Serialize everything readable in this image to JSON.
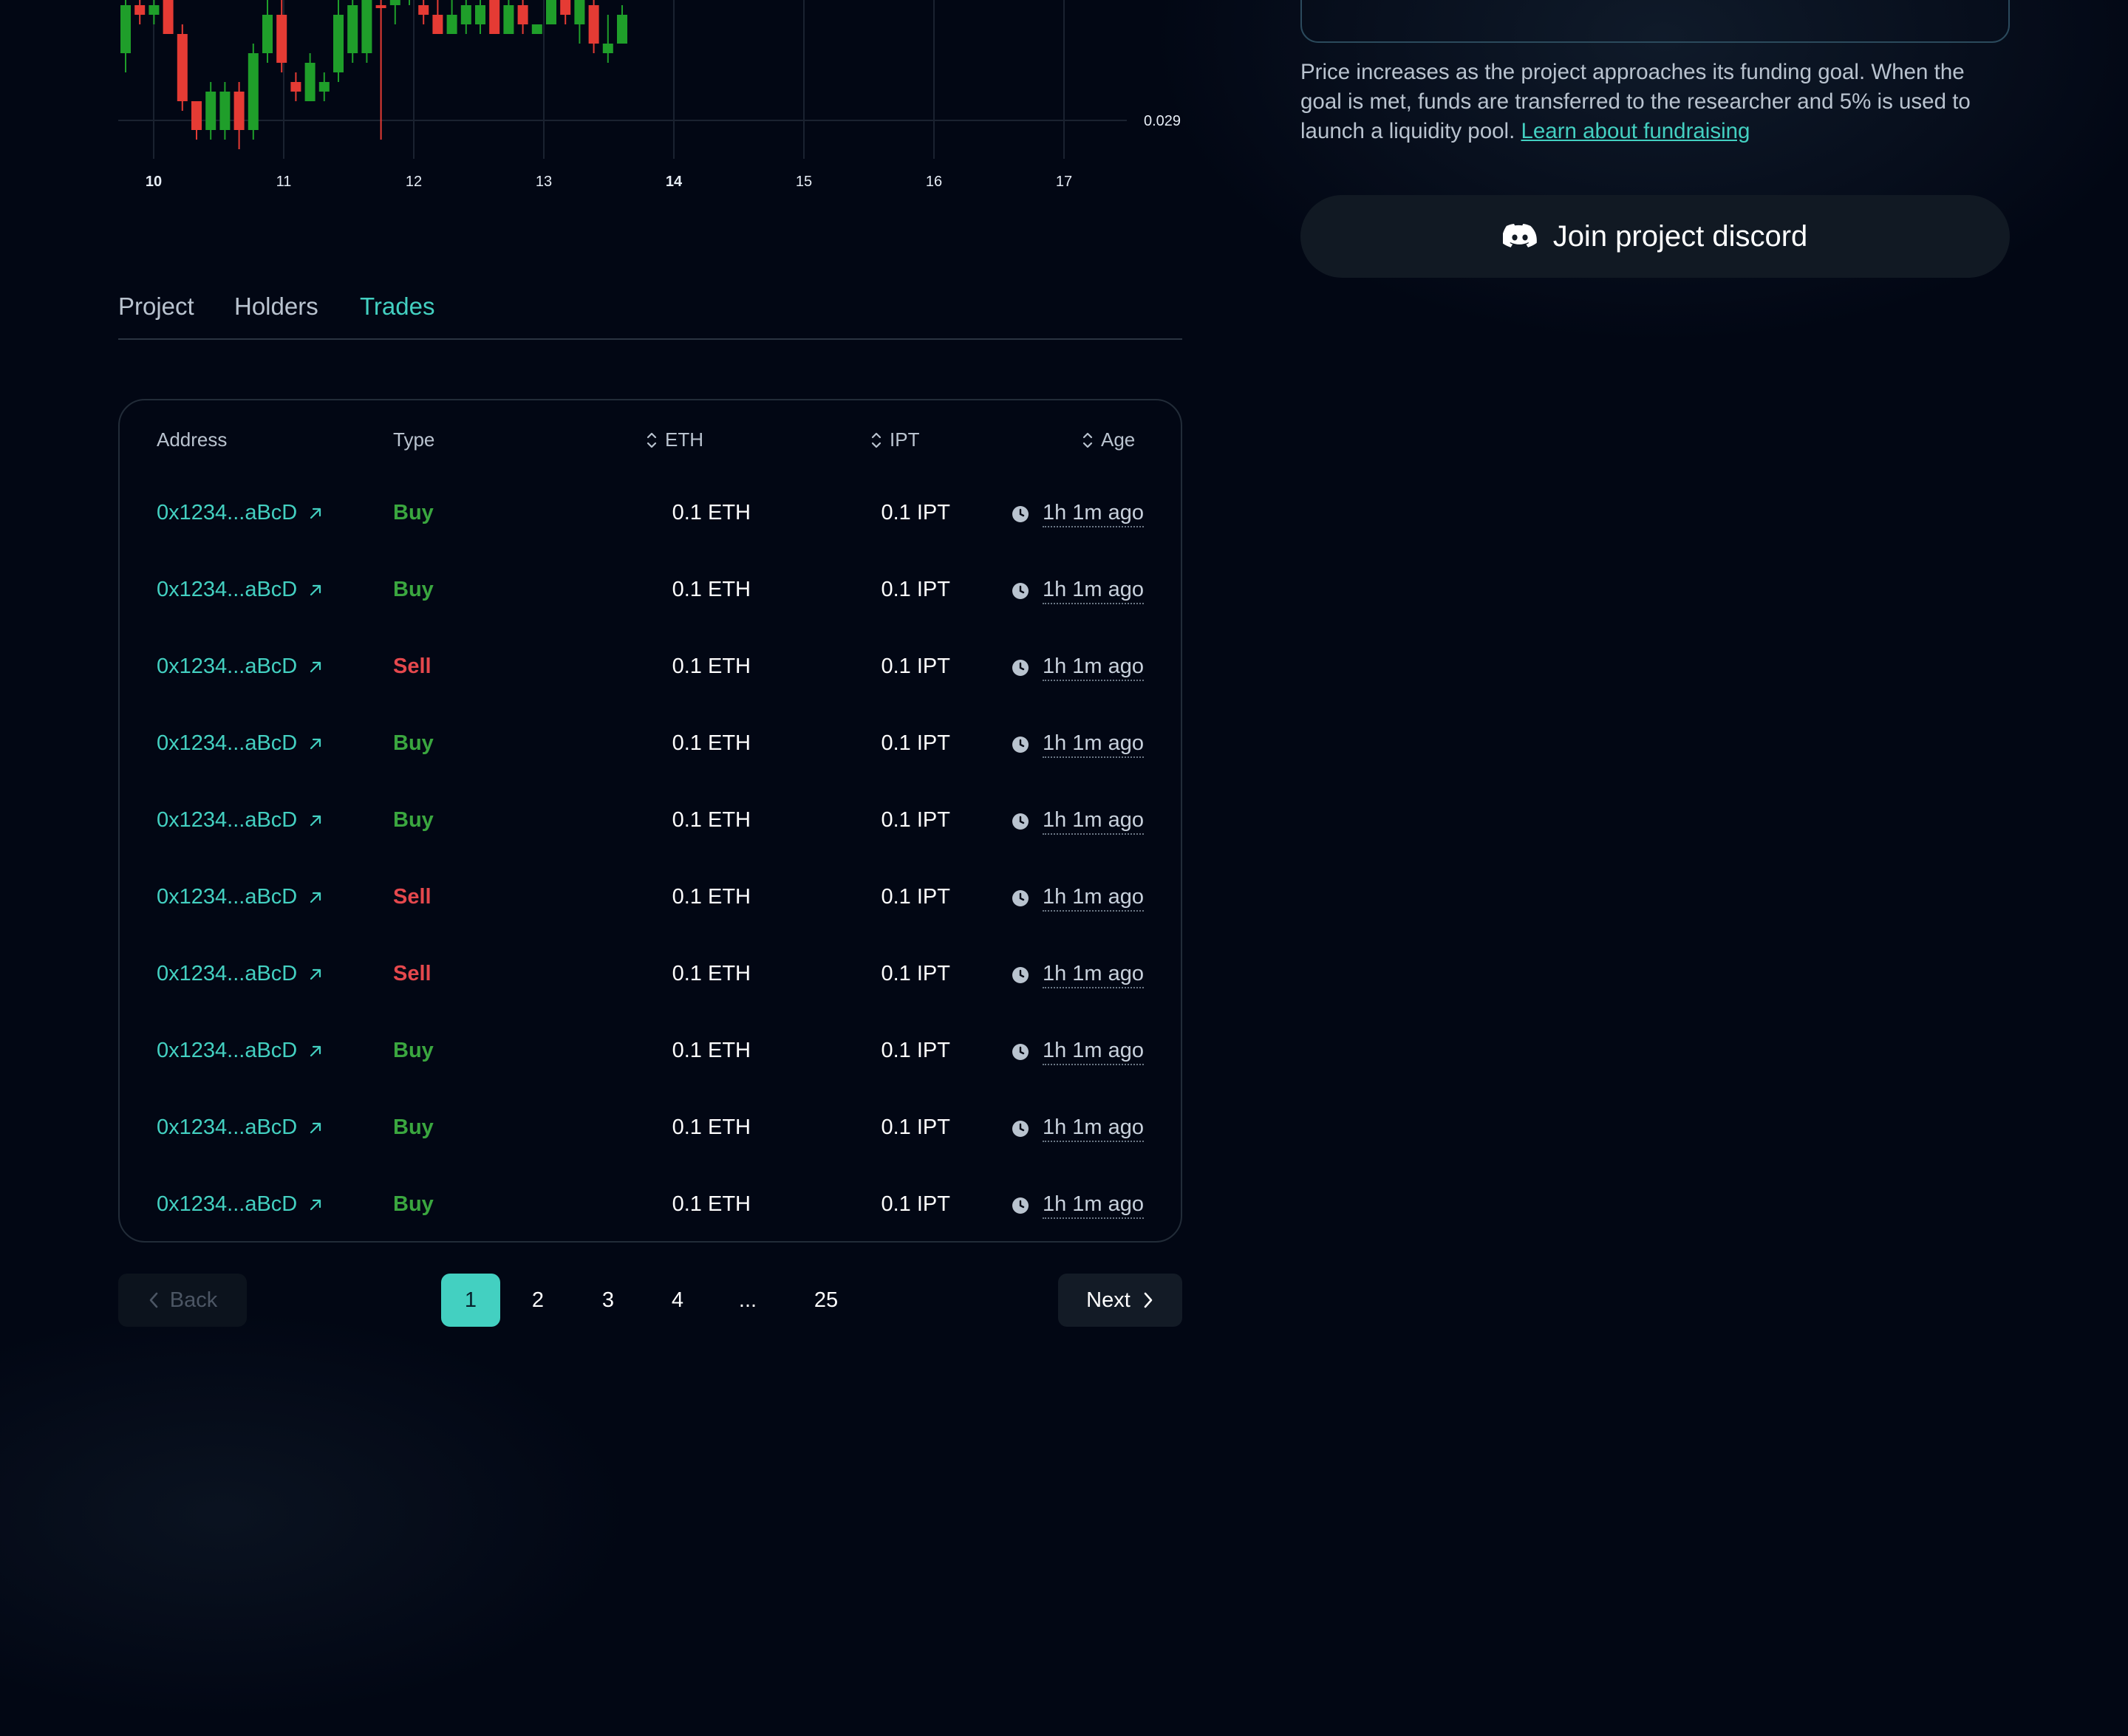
{
  "chart_data": {
    "type": "candlestick",
    "x_ticks": [
      "10",
      "11",
      "12",
      "13",
      "14",
      "15",
      "16",
      "17"
    ],
    "bold_ticks": [
      "10",
      "14"
    ],
    "y_tick_visible": "0.029",
    "candles": [
      {
        "o": 0.0297,
        "h": 0.0303,
        "l": 0.0295,
        "c": 0.0302,
        "dir": "up"
      },
      {
        "o": 0.0302,
        "h": 0.0303,
        "l": 0.03,
        "c": 0.0301,
        "dir": "down"
      },
      {
        "o": 0.0301,
        "h": 0.0303,
        "l": 0.03,
        "c": 0.0302,
        "dir": "up"
      },
      {
        "o": 0.0303,
        "h": 0.0303,
        "l": 0.0299,
        "c": 0.0299,
        "dir": "down"
      },
      {
        "o": 0.0299,
        "h": 0.03,
        "l": 0.0291,
        "c": 0.0292,
        "dir": "down"
      },
      {
        "o": 0.0292,
        "h": 0.0292,
        "l": 0.0288,
        "c": 0.0289,
        "dir": "down"
      },
      {
        "o": 0.0289,
        "h": 0.0294,
        "l": 0.0288,
        "c": 0.0293,
        "dir": "up"
      },
      {
        "o": 0.0289,
        "h": 0.0294,
        "l": 0.0288,
        "c": 0.0293,
        "dir": "up"
      },
      {
        "o": 0.0293,
        "h": 0.0294,
        "l": 0.0287,
        "c": 0.0289,
        "dir": "down"
      },
      {
        "o": 0.0289,
        "h": 0.0298,
        "l": 0.0288,
        "c": 0.0297,
        "dir": "up"
      },
      {
        "o": 0.0297,
        "h": 0.0303,
        "l": 0.0296,
        "c": 0.0301,
        "dir": "up"
      },
      {
        "o": 0.0301,
        "h": 0.0303,
        "l": 0.0295,
        "c": 0.0296,
        "dir": "down"
      },
      {
        "o": 0.0294,
        "h": 0.0295,
        "l": 0.0292,
        "c": 0.0293,
        "dir": "down"
      },
      {
        "o": 0.0292,
        "h": 0.0297,
        "l": 0.0292,
        "c": 0.0296,
        "dir": "up"
      },
      {
        "o": 0.0293,
        "h": 0.0295,
        "l": 0.0292,
        "c": 0.0294,
        "dir": "up"
      },
      {
        "o": 0.0295,
        "h": 0.0303,
        "l": 0.0294,
        "c": 0.0301,
        "dir": "up"
      },
      {
        "o": 0.0302,
        "h": 0.0303,
        "l": 0.0296,
        "c": 0.0297,
        "dir": "up"
      },
      {
        "o": 0.0303,
        "h": 0.0303,
        "l": 0.0296,
        "c": 0.0297,
        "dir": "up"
      },
      {
        "o": 0.0302,
        "h": 0.0303,
        "l": 0.0288,
        "c": 0.0302,
        "dir": "down"
      },
      {
        "o": 0.0303,
        "h": 0.0303,
        "l": 0.03,
        "c": 0.0302,
        "dir": "up"
      },
      {
        "o": 0.0303,
        "h": 0.0303,
        "l": 0.0302,
        "c": 0.0303,
        "dir": "up"
      },
      {
        "o": 0.0302,
        "h": 0.0303,
        "l": 0.03,
        "c": 0.0301,
        "dir": "down"
      },
      {
        "o": 0.0301,
        "h": 0.0303,
        "l": 0.0299,
        "c": 0.0299,
        "dir": "down"
      },
      {
        "o": 0.0299,
        "h": 0.0303,
        "l": 0.0299,
        "c": 0.0301,
        "dir": "up"
      },
      {
        "o": 0.03,
        "h": 0.0303,
        "l": 0.0299,
        "c": 0.0302,
        "dir": "up"
      },
      {
        "o": 0.0302,
        "h": 0.0303,
        "l": 0.0299,
        "c": 0.03,
        "dir": "up"
      },
      {
        "o": 0.0303,
        "h": 0.0303,
        "l": 0.0299,
        "c": 0.0299,
        "dir": "down"
      },
      {
        "o": 0.0299,
        "h": 0.0303,
        "l": 0.0299,
        "c": 0.0302,
        "dir": "up"
      },
      {
        "o": 0.0302,
        "h": 0.0303,
        "l": 0.0299,
        "c": 0.03,
        "dir": "down"
      },
      {
        "o": 0.0299,
        "h": 0.03,
        "l": 0.0299,
        "c": 0.03,
        "dir": "up"
      },
      {
        "o": 0.03,
        "h": 0.0303,
        "l": 0.03,
        "c": 0.0303,
        "dir": "up"
      },
      {
        "o": 0.0303,
        "h": 0.0303,
        "l": 0.03,
        "c": 0.0301,
        "dir": "down"
      },
      {
        "o": 0.0303,
        "h": 0.0303,
        "l": 0.0298,
        "c": 0.03,
        "dir": "up"
      },
      {
        "o": 0.0302,
        "h": 0.0303,
        "l": 0.0297,
        "c": 0.0298,
        "dir": "down"
      },
      {
        "o": 0.0297,
        "h": 0.0301,
        "l": 0.0296,
        "c": 0.0298,
        "dir": "up"
      },
      {
        "o": 0.0298,
        "h": 0.0302,
        "l": 0.0298,
        "c": 0.0301,
        "dir": "up"
      }
    ],
    "colors": {
      "up": "#1f9e2a",
      "down": "#e53b34",
      "grid": "#1a2230",
      "tick": "#e6edf5"
    }
  },
  "tabs": [
    {
      "label": "Project",
      "active": false
    },
    {
      "label": "Holders",
      "active": false
    },
    {
      "label": "Trades",
      "active": true
    }
  ],
  "table": {
    "headers": {
      "address": "Address",
      "type": "Type",
      "eth": "ETH",
      "ipt": "IPT",
      "age": "Age"
    },
    "rows": [
      {
        "address": "0x1234...aBcD",
        "type": "Buy",
        "eth": "0.1 ETH",
        "ipt": "0.1 IPT",
        "age": "1h 1m ago"
      },
      {
        "address": "0x1234...aBcD",
        "type": "Buy",
        "eth": "0.1 ETH",
        "ipt": "0.1 IPT",
        "age": "1h 1m ago"
      },
      {
        "address": "0x1234...aBcD",
        "type": "Sell",
        "eth": "0.1 ETH",
        "ipt": "0.1 IPT",
        "age": "1h 1m ago"
      },
      {
        "address": "0x1234...aBcD",
        "type": "Buy",
        "eth": "0.1 ETH",
        "ipt": "0.1 IPT",
        "age": "1h 1m ago"
      },
      {
        "address": "0x1234...aBcD",
        "type": "Buy",
        "eth": "0.1 ETH",
        "ipt": "0.1 IPT",
        "age": "1h 1m ago"
      },
      {
        "address": "0x1234...aBcD",
        "type": "Sell",
        "eth": "0.1 ETH",
        "ipt": "0.1 IPT",
        "age": "1h 1m ago"
      },
      {
        "address": "0x1234...aBcD",
        "type": "Sell",
        "eth": "0.1 ETH",
        "ipt": "0.1 IPT",
        "age": "1h 1m ago"
      },
      {
        "address": "0x1234...aBcD",
        "type": "Buy",
        "eth": "0.1 ETH",
        "ipt": "0.1 IPT",
        "age": "1h 1m ago"
      },
      {
        "address": "0x1234...aBcD",
        "type": "Buy",
        "eth": "0.1 ETH",
        "ipt": "0.1 IPT",
        "age": "1h 1m ago"
      },
      {
        "address": "0x1234...aBcD",
        "type": "Buy",
        "eth": "0.1 ETH",
        "ipt": "0.1 IPT",
        "age": "1h 1m ago"
      }
    ]
  },
  "pagination": {
    "back_label": "Back",
    "next_label": "Next",
    "pages": [
      "1",
      "2",
      "3",
      "4",
      "...",
      "25"
    ],
    "current": "1"
  },
  "sidebar": {
    "info_text": "Price increases as the project approaches its funding goal. When the goal is met, funds are transferred to the researcher and 5% is used to launch a liquidity pool.",
    "info_link": "Learn about fundraising",
    "discord_label": "Join project discord"
  },
  "colors": {
    "accent": "#43d0c1",
    "buy": "#3aa63f",
    "sell": "#e5484d",
    "background": "#020714"
  },
  "icons": [
    "sort-icon",
    "external-link-icon",
    "clock-icon",
    "chevron-left-icon",
    "chevron-right-icon",
    "discord-icon"
  ]
}
